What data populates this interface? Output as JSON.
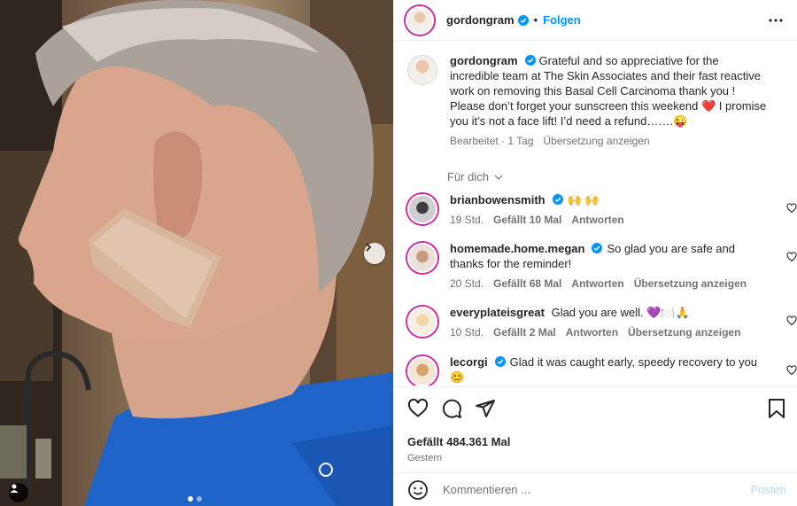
{
  "post": {
    "author": "gordongram",
    "follow_label": "Folgen",
    "separator": "•",
    "caption": "Grateful and so appreciative for the incredible team at The Skin Associates and their fast reactive work on removing this Basal Cell Carcinoma thank you ! Please don’t forget your sunscreen this weekend ❤️ I promise you it’s not a face lift! I’d need a refund…….😜",
    "caption_meta": {
      "edited": "Bearbeitet · 1 Tag",
      "translate": "Übersetzung anzeigen"
    },
    "sort_label": "Für dich"
  },
  "comments": [
    {
      "user": "brianbowensmith",
      "verified": true,
      "text": "🙌 🙌",
      "time": "19 Std.",
      "likes": "Gefällt 10 Mal",
      "reply": "Antworten",
      "translate": ""
    },
    {
      "user": "homemade.home.megan",
      "verified": true,
      "text": "So glad you are safe and thanks for the reminder!",
      "time": "20 Std.",
      "likes": "Gefällt 68 Mal",
      "reply": "Antworten",
      "translate": "Übersetzung anzeigen"
    },
    {
      "user": "everyplateisgreat",
      "verified": false,
      "text": "Glad you are well. 💜🍽️🙏",
      "time": "10 Std.",
      "likes": "Gefällt 2 Mal",
      "reply": "Antworten",
      "translate": "Übersetzung anzeigen"
    },
    {
      "user": "lecorgi",
      "verified": true,
      "text": "Glad it was caught early, speedy recovery to you 😊",
      "time": "",
      "likes": "",
      "reply": "",
      "translate": ""
    }
  ],
  "footer": {
    "likes": "Gefällt 484.361 Mal",
    "date": "Gestern",
    "comment_placeholder": "Kommentieren ...",
    "post_label": "Posten"
  },
  "colors": {
    "accent": "#0095f6",
    "verified": "#0095f6",
    "post_disabled": "#b2dffc",
    "like_red": "#ed4956"
  }
}
